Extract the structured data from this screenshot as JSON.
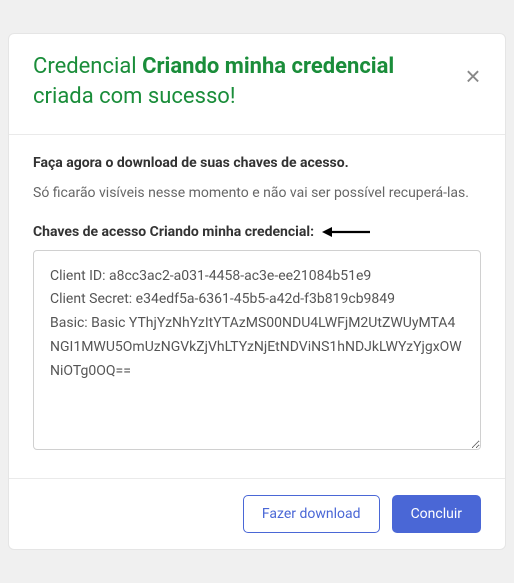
{
  "header": {
    "title_prefix": "Credencial ",
    "title_name": "Criando minha credencial",
    "title_suffix": " criada com sucesso!",
    "close_label": "×"
  },
  "body": {
    "instruction_bold": "Faça agora o download de suas chaves de acesso.",
    "instruction_note": "Só ficarão visíveis nesse momento e não vai ser possível recuperá-las.",
    "keys_label": "Chaves de acesso Criando minha credencial:",
    "keys_text": "Client ID: a8cc3ac2-a031-4458-ac3e-ee21084b51e9\nClient Secret: e34edf5a-6361-45b5-a42d-f3b819cb9849\nBasic: Basic YThjYzNhYzItYTAzMS00NDU4LWFjM2UtZWUyMTA4NGI1MWU5OmUzNGVkZjVhLTYzNjEtNDViNS1hNDJkLWYzYjgxOWNiOTg0OQ=="
  },
  "footer": {
    "download_label": "Fazer download",
    "finish_label": "Concluir"
  },
  "colors": {
    "accent_green": "#1a8d3a",
    "primary_blue": "#4a67d6"
  }
}
